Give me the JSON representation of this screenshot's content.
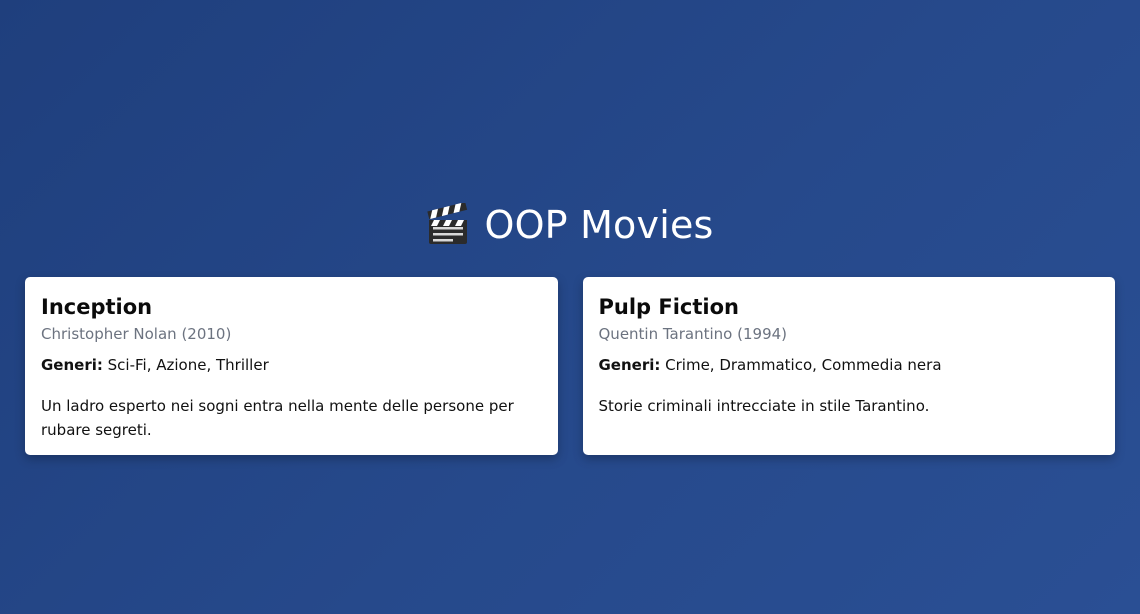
{
  "header": {
    "icon": "clapperboard-icon",
    "title": "OOP Movies"
  },
  "movies": [
    {
      "title": "Inception",
      "director": "Christopher Nolan",
      "year": "(2010)",
      "genres_label": "Generi:",
      "genres": "Sci-Fi, Azione, Thriller",
      "description": "Un ladro esperto nei sogni entra nella mente delle persone per rubare segreti."
    },
    {
      "title": "Pulp Fiction",
      "director": "Quentin Tarantino",
      "year": "(1994)",
      "genres_label": "Generi:",
      "genres": "Crime, Drammatico, Commedia nera",
      "description": "Storie criminali intrecciate in stile Tarantino."
    }
  ],
  "colors": {
    "background": "#26498b",
    "card": "#ffffff",
    "subtitle": "#6c7380"
  }
}
